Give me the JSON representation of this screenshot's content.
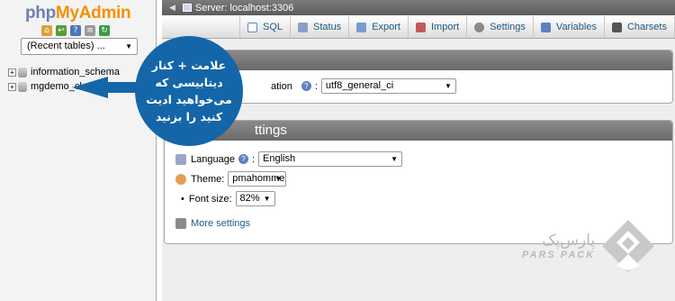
{
  "logo": {
    "part1": "php",
    "part2": "MyAdmin"
  },
  "left_panel": {
    "recent_tables": "(Recent tables) ...",
    "databases": [
      "information_schema",
      "mgdemo_clone"
    ],
    "nav_icons": [
      "home-icon",
      "exit-icon",
      "help-icon",
      "docs-icon",
      "reload-icon"
    ]
  },
  "topbar": {
    "server": "Server: localhost:3306"
  },
  "tabs": [
    "SQL",
    "Status",
    "Export",
    "Import",
    "Settings",
    "Variables",
    "Charsets"
  ],
  "general": {
    "collation_label_partial": "ation",
    "collation_value": "utf8_general_ci"
  },
  "appearance": {
    "title_partial": "ttings",
    "language_label": "Language",
    "language_value": "English",
    "theme_label": "Theme:",
    "theme_value": "pmahomme",
    "font_size_label": "Font size:",
    "font_size_value": "82%",
    "more_settings": "More settings"
  },
  "callout": {
    "text": "علامت + کنار دیتابیسی که می‌خواهید ادیت کنید را بزنید"
  },
  "watermark": {
    "fa": "پارس‌پک",
    "en": "PARS PACK"
  },
  "colors": {
    "callout_bg": "#1466a8",
    "php": "#6c7eb7",
    "myadmin": "#f29200",
    "link": "#235a81"
  }
}
